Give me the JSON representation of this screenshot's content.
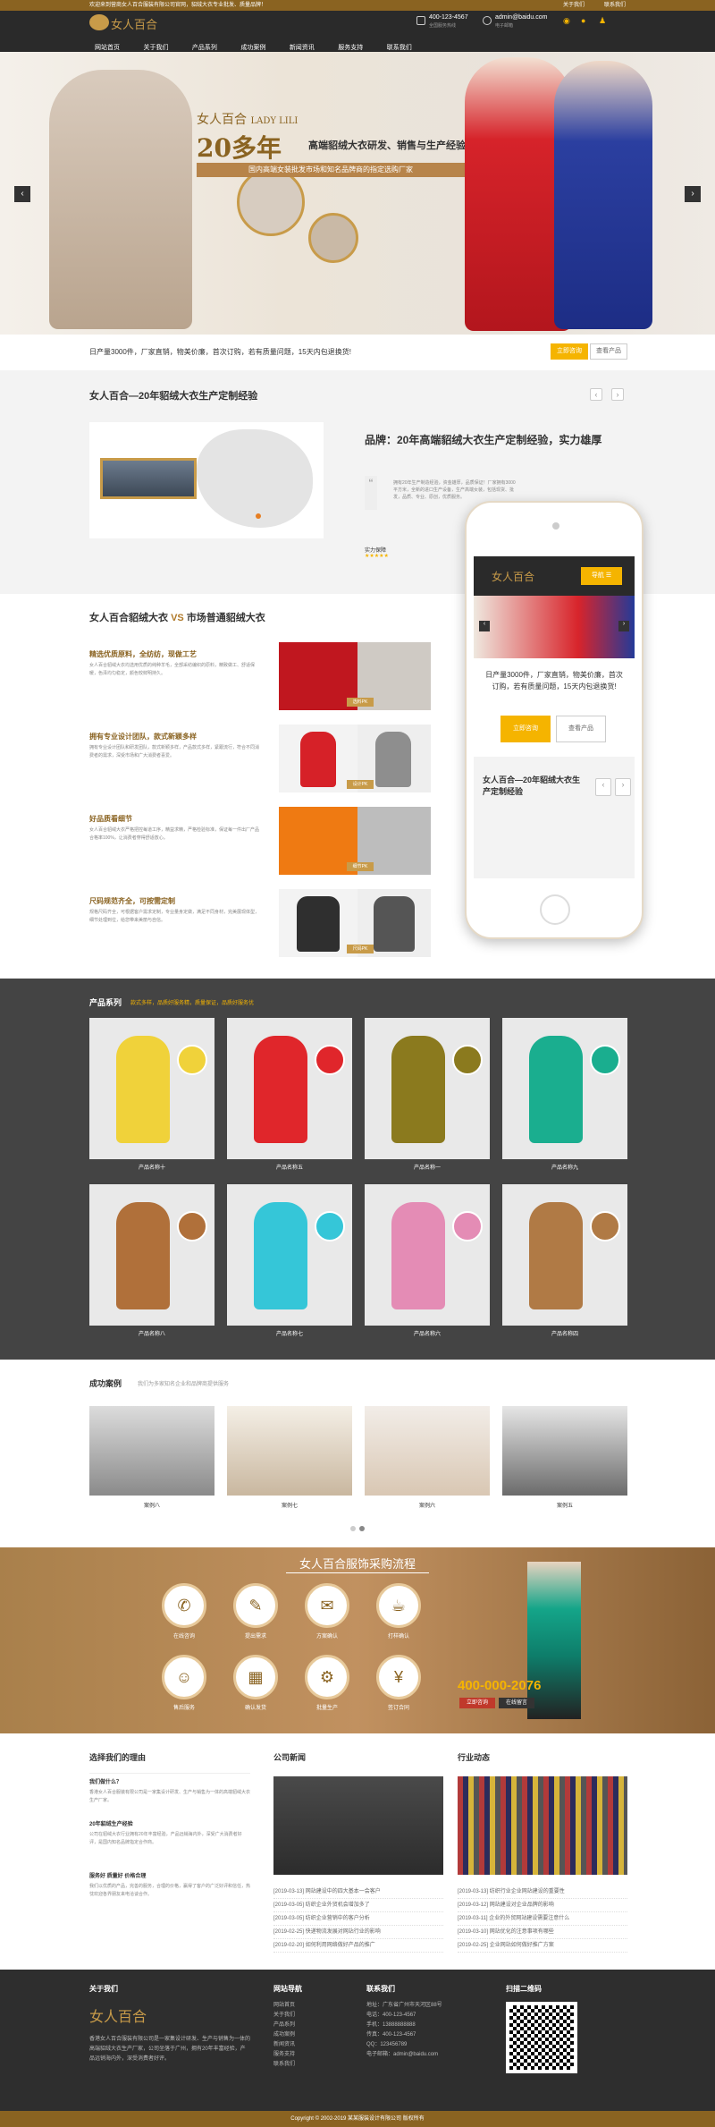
{
  "topbar": {
    "text": "欢迎来到营商女人百合服装有限公司官网，貂绒大衣专业批发、质量品牌！",
    "links": [
      "关于我们",
      "联系我们"
    ]
  },
  "header": {
    "logo_cn": "女人百合",
    "phone": "400-123-4567",
    "phone_sub": "全国服务热线",
    "email": "admin@baidu.com",
    "email_sub": "电子邮箱"
  },
  "nav": [
    "网站首页",
    "关于我们",
    "产品系列",
    "成功案例",
    "新闻资讯",
    "服务支持",
    "联系我们"
  ],
  "hero": {
    "brand_cn": "女人百合",
    "brand_en": "LADY LILI",
    "headline": "20多年",
    "sub": "高端貂绒大衣研发、销售与生产经验",
    "tagline": "国内高端女装批发市场和知名品牌商的指定选购厂家"
  },
  "notice": {
    "text": "日产量3000件，厂家直销，物美价廉，首次订购，若有质量问题，15天内包退换货!",
    "btn_primary": "立即咨询",
    "btn_secondary": "查看产品"
  },
  "about": {
    "title": "女人百合—20年貂绒大衣生产定制经验",
    "headline": "品牌：20年高端貂绒大衣生产定制经验，实力雄厚",
    "quote": "拥有20年生产制造经验，资金雄厚，品质保证！厂家拥有3000平方米，全新的进口生产设备，生产高端女装，包括现货、批发，品质、专业、原创，优质服务。",
    "rating_label": "实力保障"
  },
  "compare": {
    "title_a": "女人百合貂绒大衣",
    "vs": "VS",
    "title_b": "市场普通貂绒大衣",
    "items": [
      {
        "title": "精选优质原料，全纺纺，现做工艺",
        "text": "女人百合貂绒大衣均选用优质的纯种羊毛，全部采纺编织的原料，精致做工、舒适保暖，色泽均匀稳定，颜色较鲜明持久。",
        "tag": "选料PK"
      },
      {
        "title": "拥有专业设计团队，款式新颖多样",
        "text": "拥有专业设计团队和研发团队，款式新颖多样，产品款式多样，紧跟流行，符合不同消费者的需求，深受市场和广大消费者喜爱。",
        "tag": "设计PK"
      },
      {
        "title": "好品质看细节",
        "text": "女人百合貂绒大衣严格把控每道工序，精益求精，严格检验标准，保证每一件出厂产品合格率100%，让消费者穿得舒适放心。",
        "tag": "细节PK"
      },
      {
        "title": "尺码规范齐全，可按需定制",
        "text": "规格尺码齐全，可根据客户需求定制，专业量身定做，满足不同身材，完美展现体型，细节处理到位，给您带来美丽与自信。",
        "tag": "尺码PK"
      }
    ]
  },
  "phone_mock": {
    "nav_label": "导航",
    "notice": "日产量3000件，厂家直销，物美价廉，首次订购，若有质量问题，15天内包退换货!",
    "btn_primary": "立即咨询",
    "btn_secondary": "查看产品",
    "title": "女人百合—20年貂绒大衣生产定制经验"
  },
  "products": {
    "title": "产品系列",
    "subtitle": "款式多样，品质好服务精，质量保证，品质好服务优",
    "items": [
      "产品名称十",
      "产品名称五",
      "产品名称一",
      "产品名称九",
      "产品名称八",
      "产品名称七",
      "产品名称六",
      "产品名称四"
    ],
    "colors": [
      "#f0d23a",
      "#e0262b",
      "#8b7a1e",
      "#1aae8f",
      "#b0703a",
      "#35c6d8",
      "#e48cb5",
      "#b07a45"
    ]
  },
  "cases": {
    "title": "成功案例",
    "subtitle": "我们为多家知名企业和品牌商提供服务",
    "items": [
      "案例八",
      "案例七",
      "案例六",
      "案例五"
    ]
  },
  "process": {
    "title": "女人百合服饰采购流程",
    "steps": [
      "在线咨询",
      "提出需求",
      "方案确认",
      "打样确认",
      "售后服务",
      "确认发货",
      "批量生产",
      "签订合同"
    ],
    "promo_phone": "400-000-2076",
    "promo_btn": "立即咨询",
    "promo_btn2": "在线留言"
  },
  "why": {
    "title": "选择我们的理由",
    "items": [
      {
        "h": "我们做什么？",
        "t": "香港女人百合服装有限公司是一家集设计研发、生产与销售为一体的高端貂绒大衣生产厂家。"
      },
      {
        "h": "20年貂绒生产经验",
        "t": "公司在貂绒大衣行业拥有20年丰富经验，产品远销海内外，深受广大消费者好评，是国内知名品牌指定合作商。"
      },
      {
        "h": "服务好 质量好 价格合理",
        "t": "我们以优质的产品，完善的服务，合理的价格，赢得了客户的广泛好评和信任，热忱欢迎各界朋友来电洽谈合作。"
      }
    ]
  },
  "news": {
    "title": "公司新闻",
    "items": [
      "[2019-03-13] 网站建设中的四大基本一会客户",
      "[2019-03-05] 纺织企业外贸机会增加多了",
      "[2019-03-05] 纺织企业营销中的客户分析",
      "[2019-02-25] 快递物流发展对网站行业的影响",
      "[2019-02-20] 如何利用网络做好产品的推广"
    ]
  },
  "industry": {
    "title": "行业动态",
    "items": [
      "[2019-03-13] 纺织行业企业网站建设的重要性",
      "[2019-03-12] 网站建设对企业品牌的影响",
      "[2019-03-11] 企业的外贸网站建设需要注意什么",
      "[2019-03-10] 网站优化的注意事项有哪些",
      "[2019-02-25] 企业网站如何做好推广方案"
    ]
  },
  "footer": {
    "about_title": "关于我们",
    "about_text": "香港女人百合服装有限公司是一家集设计研发、生产与销售为一体的高端貂绒大衣生产厂家，公司坐落于广州，拥有20年丰富经验，产品远销海内外，深受消费者好评。",
    "nav_title": "网站导航",
    "nav_items": [
      "网站首页",
      "关于我们",
      "产品系列",
      "成功案例",
      "新闻资讯",
      "服务支持",
      "联系我们"
    ],
    "contact_title": "联系我们",
    "contact_items": [
      "地址：广东省广州市天河区88号",
      "电话：400-123-4567",
      "手机：13888888888",
      "传真：400-123-4567",
      "QQ：123456789",
      "电子邮箱：admin@baidu.com"
    ],
    "qr_title": "扫描二维码",
    "copyright": "Copyright © 2002-2019 某某服装设计有限公司 版权所有"
  }
}
